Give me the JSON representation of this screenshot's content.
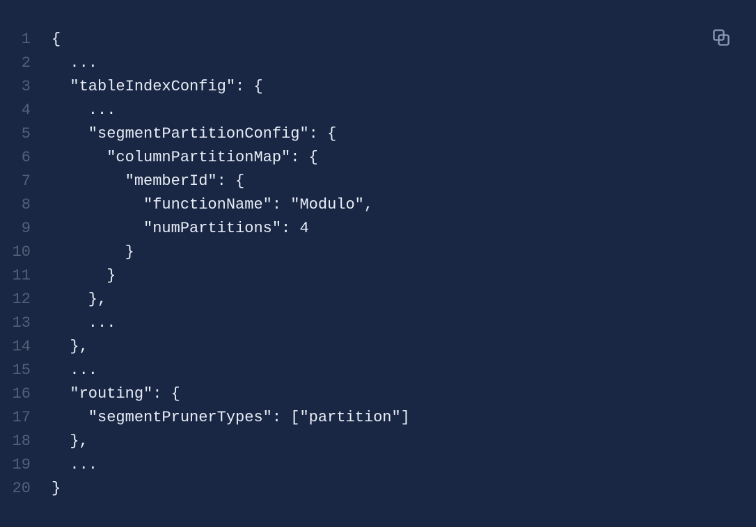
{
  "lineNumbers": [
    "1",
    "2",
    "3",
    "4",
    "5",
    "6",
    "7",
    "8",
    "9",
    "10",
    "11",
    "12",
    "13",
    "14",
    "15",
    "16",
    "17",
    "18",
    "19",
    "20"
  ],
  "codeLines": [
    "{",
    "  ...",
    "  \"tableIndexConfig\": {",
    "    ...",
    "    \"segmentPartitionConfig\": {",
    "      \"columnPartitionMap\": {",
    "        \"memberId\": {",
    "          \"functionName\": \"Modulo\",",
    "          \"numPartitions\": 4",
    "        }",
    "      }",
    "    },",
    "    ...",
    "  },",
    "  ...",
    "  \"routing\": {",
    "    \"segmentPrunerTypes\": [\"partition\"]",
    "  },",
    "  ...",
    "}"
  ],
  "copyIconName": "copy-icon"
}
